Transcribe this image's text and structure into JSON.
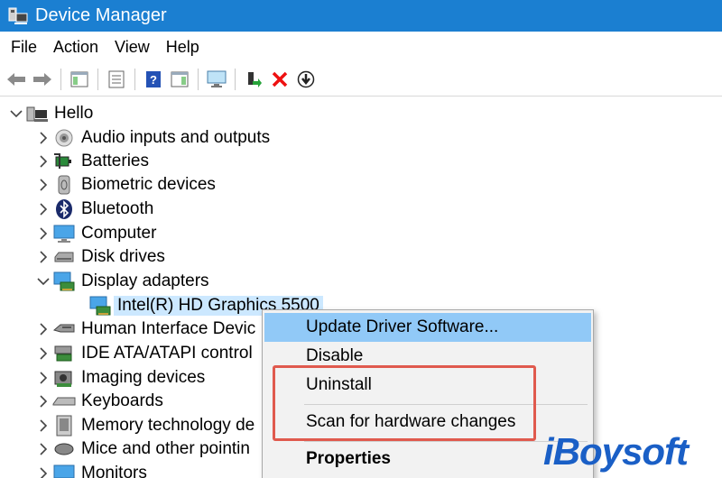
{
  "window": {
    "title": "Device Manager"
  },
  "menu": [
    "File",
    "Action",
    "View",
    "Help"
  ],
  "toolbar": [
    "back",
    "forward",
    "show-hide-console-tree",
    "properties",
    "help",
    "action-pane",
    "scan-for-hardware",
    "update-driver",
    "uninstall",
    "disable"
  ],
  "tree": {
    "root": "Hello",
    "items": [
      {
        "label": "Audio inputs and outputs",
        "icon": "speaker-icon",
        "expanded": false
      },
      {
        "label": "Batteries",
        "icon": "battery-icon",
        "expanded": false
      },
      {
        "label": "Biometric devices",
        "icon": "fingerprint-icon",
        "expanded": false
      },
      {
        "label": "Bluetooth",
        "icon": "bluetooth-icon",
        "expanded": false
      },
      {
        "label": "Computer",
        "icon": "computer-icon",
        "expanded": false
      },
      {
        "label": "Disk drives",
        "icon": "disk-drive-icon",
        "expanded": false
      },
      {
        "label": "Display adapters",
        "icon": "display-adapter-icon",
        "expanded": true
      },
      {
        "label": "Human Interface Devic",
        "icon": "hid-icon",
        "expanded": false
      },
      {
        "label": "IDE ATA/ATAPI control",
        "icon": "ide-icon",
        "expanded": false
      },
      {
        "label": "Imaging devices",
        "icon": "camera-icon",
        "expanded": false
      },
      {
        "label": "Keyboards",
        "icon": "keyboard-icon",
        "expanded": false
      },
      {
        "label": "Memory technology de",
        "icon": "memory-icon",
        "expanded": false
      },
      {
        "label": "Mice and other pointin",
        "icon": "mouse-icon",
        "expanded": false
      },
      {
        "label": "Monitors",
        "icon": "monitor-icon",
        "expanded": false
      }
    ],
    "child": {
      "label": "Intel(R) HD Graphics 5500",
      "icon": "display-adapter-icon"
    }
  },
  "context_menu": {
    "items": [
      {
        "label": "Update Driver Software..."
      },
      {
        "label": "Disable"
      },
      {
        "label": "Uninstall"
      },
      {
        "label": "Scan for hardware changes"
      },
      {
        "label": "Properties"
      }
    ]
  },
  "watermark": {
    "text": "iBoysoft"
  },
  "colors": {
    "titlebar": "#1b7fd1",
    "highlight": "#91c9f7",
    "selection": "#cce8ff",
    "annotation": "#e05a4e",
    "watermark": "#1a5fc6"
  }
}
